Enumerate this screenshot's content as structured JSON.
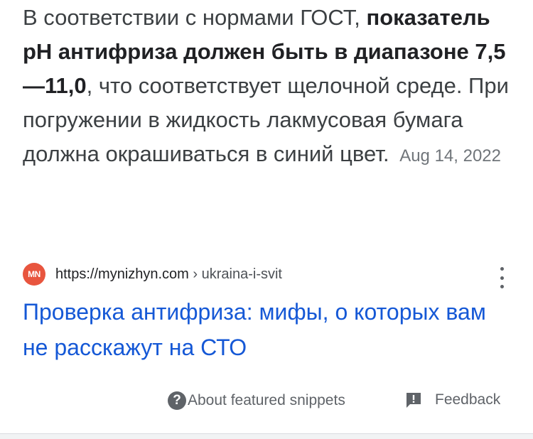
{
  "snippet": {
    "text_before": "В соответствии с нормами ГОСТ, ",
    "bold_text": "показатель pH антифриза должен быть в диапазоне 7,5—11,0",
    "text_after": ", что соответствует щелочной среде. При погружении в жидкость лакмусовая бумага должна окрашиваться в синий цвет.",
    "date": "Aug 14, 2022"
  },
  "source": {
    "favicon_text": "MN",
    "favicon_color": "#e8553e",
    "domain": "https://mynizhyn.com",
    "breadcrumb": " › ukraina-i-svit",
    "more_icon": "kebab-vertical-icon"
  },
  "result": {
    "title": "Проверка антифриза: мифы, о которых вам не расскажут на СТО",
    "link_color": "#1558d6"
  },
  "footer": {
    "about_label": "About featured snippets",
    "about_icon": "help-circle-icon",
    "feedback_label": "Feedback",
    "feedback_icon": "feedback-icon"
  }
}
